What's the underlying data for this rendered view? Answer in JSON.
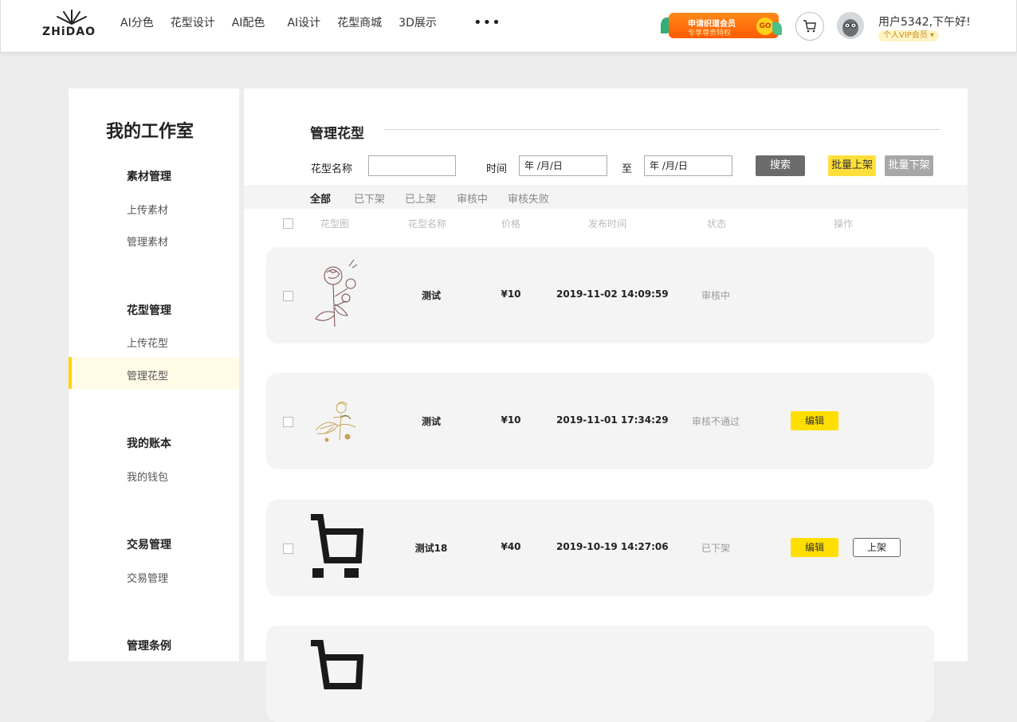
{
  "header": {
    "logo_text": "ZHiDAO",
    "nav": [
      "AI分色",
      "花型设计",
      "AI配色",
      "AI设计",
      "花型商城",
      "3D展示"
    ],
    "more": "•••",
    "vip_banner": {
      "title": "申请织道会员",
      "subtitle": "专享尊贵特权",
      "go": "GO"
    },
    "greeting": "用户5342,下午好!",
    "member_badge": "个人VIP会员 ▾"
  },
  "sidebar": {
    "title": "我的工作室",
    "sections": [
      {
        "title": "素材管理",
        "items": [
          "上传素材",
          "管理素材"
        ]
      },
      {
        "title": "花型管理",
        "items": [
          "上传花型",
          "管理花型"
        ]
      },
      {
        "title": "我的账本",
        "items": [
          "我的钱包"
        ]
      },
      {
        "title": "交易管理",
        "items": [
          "交易管理"
        ]
      },
      {
        "title": "管理条例",
        "items": []
      }
    ],
    "active_item": "管理花型"
  },
  "main": {
    "title": "管理花型",
    "search": {
      "name_label": "花型名称",
      "name_value": "",
      "time_label": "时间",
      "date_from": "年 /月/日",
      "to_label": "至",
      "date_to": "年 /月/日",
      "search_button": "搜索",
      "batch_up": "批量上架",
      "batch_down": "批量下架"
    },
    "filters": [
      "全部",
      "已下架",
      "已上架",
      "审核中",
      "审核失败"
    ],
    "active_filter": "全部",
    "columns": [
      "花型图",
      "花型名称",
      "价格",
      "发布时间",
      "状态",
      "操作"
    ],
    "rows": [
      {
        "name": "测试",
        "price": "¥10",
        "time": "2019-11-02 14:09:59",
        "status": "审核中",
        "thumb": "rose-sketch-icon",
        "actions": []
      },
      {
        "name": "测试",
        "price": "¥10",
        "time": "2019-11-01 17:34:29",
        "status": "审核不通过",
        "thumb": "golden-flower-icon",
        "actions": [
          "编辑"
        ]
      },
      {
        "name": "测试18",
        "price": "¥40",
        "time": "2019-10-19 14:27:06",
        "status": "已下架",
        "thumb": "cart-icon",
        "actions": [
          "编辑",
          "上架"
        ]
      },
      {
        "name": "",
        "price": "",
        "time": "",
        "status": "",
        "thumb": "cart-icon",
        "actions": []
      }
    ]
  },
  "colors": {
    "accent": "#ffde00",
    "active_bg": "#fffbe6",
    "row_bg": "#f4f4f4"
  }
}
